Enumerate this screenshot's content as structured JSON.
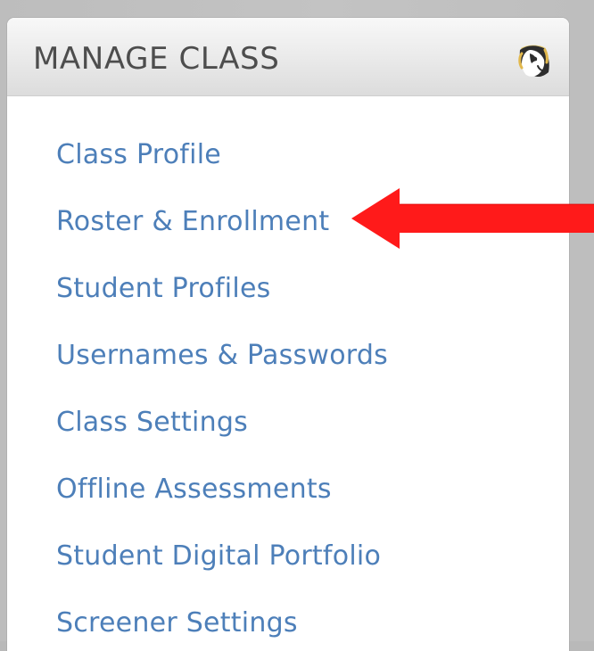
{
  "panel": {
    "title": "MANAGE CLASS",
    "logo_icon": "mascot-logo-icon",
    "items": [
      {
        "label": "Class Profile"
      },
      {
        "label": "Roster & Enrollment"
      },
      {
        "label": "Student Profiles"
      },
      {
        "label": "Usernames & Passwords"
      },
      {
        "label": "Class Settings"
      },
      {
        "label": "Offline Assessments"
      },
      {
        "label": "Student Digital Portfolio"
      },
      {
        "label": "Screener Settings"
      }
    ]
  },
  "colors": {
    "link": "#4d7fb9",
    "title": "#4d4d4d",
    "background": "#bdbdbd",
    "arrow": "#ff1a1a"
  }
}
